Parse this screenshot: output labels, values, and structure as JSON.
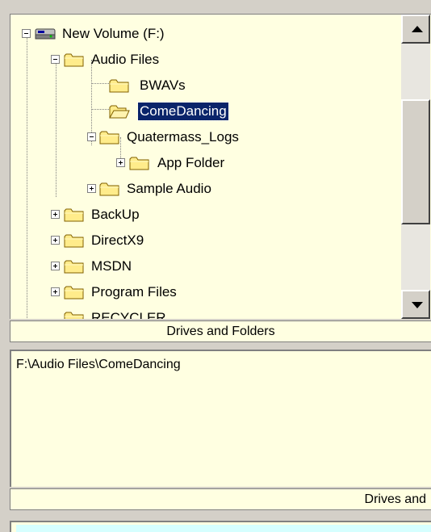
{
  "tree": {
    "items": [
      {
        "label": "New Volume (F:)",
        "icon": "drive-icon",
        "expander": "minus"
      },
      {
        "label": "Audio Files",
        "icon": "folder-icon",
        "expander": "minus"
      },
      {
        "label": "BWAVs",
        "icon": "folder-icon",
        "expander": "none"
      },
      {
        "label": "ComeDancing",
        "icon": "folder-open-icon",
        "expander": "none",
        "selected": true
      },
      {
        "label": "Quatermass_Logs",
        "icon": "folder-icon",
        "expander": "minus"
      },
      {
        "label": "App Folder",
        "icon": "folder-icon",
        "expander": "plus"
      },
      {
        "label": "Sample Audio",
        "icon": "folder-icon",
        "expander": "plus"
      },
      {
        "label": "BackUp",
        "icon": "folder-icon",
        "expander": "plus"
      },
      {
        "label": "DirectX9",
        "icon": "folder-icon",
        "expander": "plus"
      },
      {
        "label": "MSDN",
        "icon": "folder-icon",
        "expander": "plus"
      },
      {
        "label": "Program Files",
        "icon": "folder-icon",
        "expander": "plus"
      },
      {
        "label": "RECYCLER",
        "icon": "folder-icon",
        "expander": "plus"
      }
    ]
  },
  "captions": {
    "drives_folders": "Drives and Folders",
    "drives_and_partial": "Drives and"
  },
  "path_panel": {
    "path": "F:\\Audio Files\\ComeDancing"
  },
  "colors": {
    "panel_background": "#ffffe1",
    "selection": "#0a246a",
    "chrome": "#d4d0c8"
  }
}
